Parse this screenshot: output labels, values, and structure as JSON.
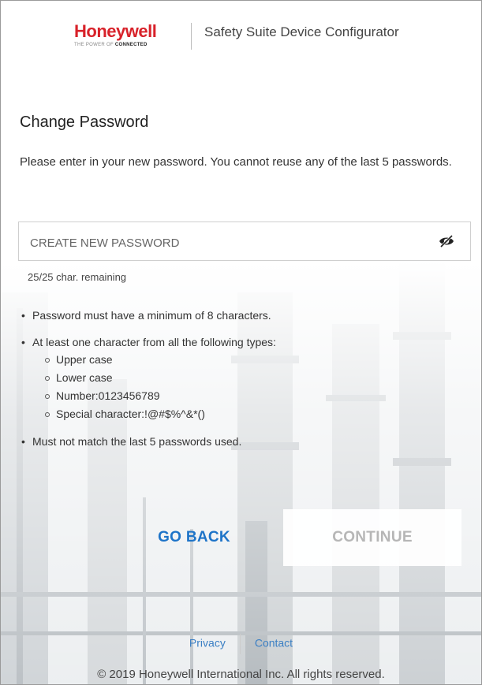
{
  "header": {
    "logo_text": "Honeywell",
    "logo_tagline_prefix": "THE POWER OF ",
    "logo_tagline_bold": "CONNECTED",
    "app_title": "Safety Suite Device Configurator"
  },
  "page": {
    "title": "Change Password",
    "intro": "Please enter in your new password. You cannot reuse any of the last 5 passwords."
  },
  "password_field": {
    "placeholder": "CREATE NEW PASSWORD",
    "value": "",
    "toggle_icon": "eye-slash-icon",
    "remaining_text": "25/25 char. remaining"
  },
  "rules": {
    "min_length": "Password must have a minimum of 8 characters.",
    "types_intro": "At least one character from all the following types:",
    "types": [
      "Upper case",
      "Lower case",
      "Number:0123456789",
      "Special character:!@#$%^&*()"
    ],
    "no_reuse": "Must not match the last 5 passwords used."
  },
  "actions": {
    "back_label": "GO BACK",
    "continue_label": "CONTINUE"
  },
  "footer": {
    "privacy_label": "Privacy",
    "contact_label": "Contact",
    "copyright": "© 2019 Honeywell International Inc. All rights reserved."
  },
  "colors": {
    "brand_red": "#d8222a",
    "link_blue": "#1e74c8",
    "disabled_gray": "#b6b6b6"
  }
}
